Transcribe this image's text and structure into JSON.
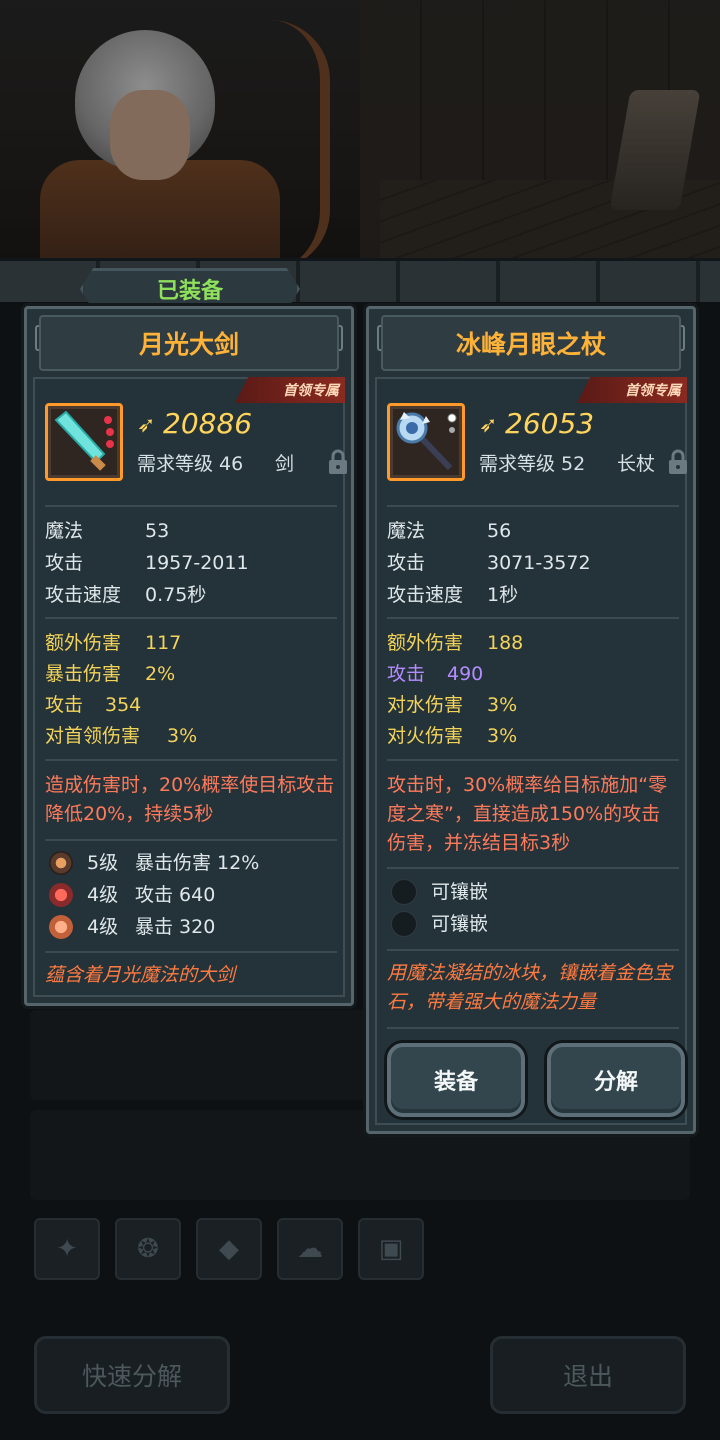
{
  "equipped_tab": "已装备",
  "boss_badge": "首领专属",
  "left_item": {
    "name": "月光大剑",
    "power": "20886",
    "requirement": "需求等级 46",
    "weapon_type": "剑",
    "base_stats": [
      {
        "label": "魔法",
        "value": "53"
      },
      {
        "label": "攻击",
        "value": "1957-2011"
      },
      {
        "label": "攻击速度",
        "value": "0.75秒"
      }
    ],
    "bonus_stats": [
      {
        "label": "额外伤害",
        "value": "117"
      },
      {
        "label": "暴击伤害",
        "value": "2%"
      },
      {
        "label": "攻击",
        "value": "354"
      },
      {
        "label": "对首领伤害",
        "value": "3%"
      }
    ],
    "effect": "造成伤害时，20%概率使目标攻击降低20%，持续5秒",
    "gems": [
      {
        "level": "5级",
        "stat": "暴击伤害 12%"
      },
      {
        "level": "4级",
        "stat": "攻击 640"
      },
      {
        "level": "4级",
        "stat": "暴击 320"
      }
    ],
    "flavor": "蕴含着月光魔法的大剑"
  },
  "right_item": {
    "name": "冰峰月眼之杖",
    "power": "26053",
    "requirement": "需求等级 52",
    "weapon_type": "长杖",
    "base_stats": [
      {
        "label": "魔法",
        "value": "56"
      },
      {
        "label": "攻击",
        "value": "3071-3572"
      },
      {
        "label": "攻击速度",
        "value": "1秒"
      }
    ],
    "bonus_stats": [
      {
        "label": "额外伤害",
        "value": "188"
      },
      {
        "label": "攻击",
        "value": "490"
      },
      {
        "label": "对水伤害",
        "value": "3%"
      },
      {
        "label": "对火伤害",
        "value": "3%"
      }
    ],
    "effect": "攻击时，30%概率给目标施加“零度之寒”，直接造成150%的攻击伤害，并冻结目标3秒",
    "sockets": [
      "可镶嵌",
      "可镶嵌"
    ],
    "flavor": "用魔法凝结的冰块，镶嵌着金色宝石，带着强大的魔法力量",
    "equip_button": "装备",
    "dismantle_button": "分解"
  },
  "bottom": {
    "quick_dismantle": "快速分解",
    "exit": "退出"
  },
  "colors": {
    "title": "#ffb238",
    "power": "#ffd45c",
    "bonus": "#f3d35a",
    "special": "#b58cff",
    "effect": "#ff7a5a",
    "equipped": "#8fe05a"
  },
  "icons": [
    "power-icon",
    "lock-icon",
    "sword-icon",
    "staff-icon",
    "category-icons"
  ]
}
